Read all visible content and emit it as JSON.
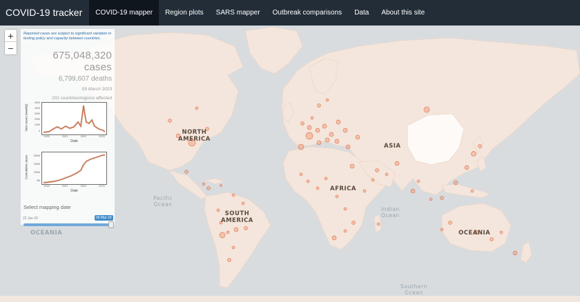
{
  "app": {
    "title": "COVID-19 tracker"
  },
  "nav": {
    "items": [
      {
        "label": "COVID-19 mapper",
        "active": true
      },
      {
        "label": "Region plots",
        "active": false
      },
      {
        "label": "SARS mapper",
        "active": false
      },
      {
        "label": "Outbreak comparisons",
        "active": false
      },
      {
        "label": "Data",
        "active": false
      },
      {
        "label": "About this site",
        "active": false
      }
    ]
  },
  "zoom": {
    "in_label": "+",
    "out_label": "−"
  },
  "panel": {
    "disclaimer": "Reported cases are subject to significant variation in testing policy and capacity between countries.",
    "cases": "675,048,320 cases",
    "deaths": "6,799,607 deaths",
    "date": "09 March 2023",
    "affected": "202 countries/regions affected"
  },
  "new_cases_plot": {
    "ylabel": "New cases (weekly)",
    "xlabel": "Date",
    "yticks": [
      "5000",
      "4000",
      "3000",
      "2000",
      "1000",
      "0"
    ],
    "xticks": [
      "2020",
      "2021",
      "2022",
      "2023"
    ]
  },
  "cumulative_plot": {
    "ylabel": "Cumulative cases",
    "xlabel": "Date",
    "yticks": [
      "600M",
      "400M",
      "200M",
      "0M"
    ],
    "xticks": [
      "2020",
      "2021",
      "2022",
      "2023"
    ]
  },
  "slider": {
    "label": "Select mapping date",
    "min": "22 Jan 20",
    "max": "09 Mar 23",
    "value_fraction": 1.0
  },
  "map_labels": {
    "north_america": [
      "NORTH",
      "AMERICA"
    ],
    "south_america": [
      "SOUTH",
      "AMERICA"
    ],
    "africa": "AFRICA",
    "asia": "ASIA",
    "oceania": "OCEANIA",
    "oceania_left": "OCEANIA",
    "pacific": [
      "Pacific",
      "Ocean"
    ],
    "indian": [
      "Indian",
      "Ocean"
    ],
    "southern": [
      "Southern",
      "Ocean"
    ]
  },
  "colors": {
    "navbar": "#222d38",
    "nav_active": "#0f161d",
    "land": "#f4e6dc",
    "ocean": "#d9dcdf",
    "marker": "#e87d57",
    "slider": "#428bca"
  }
}
